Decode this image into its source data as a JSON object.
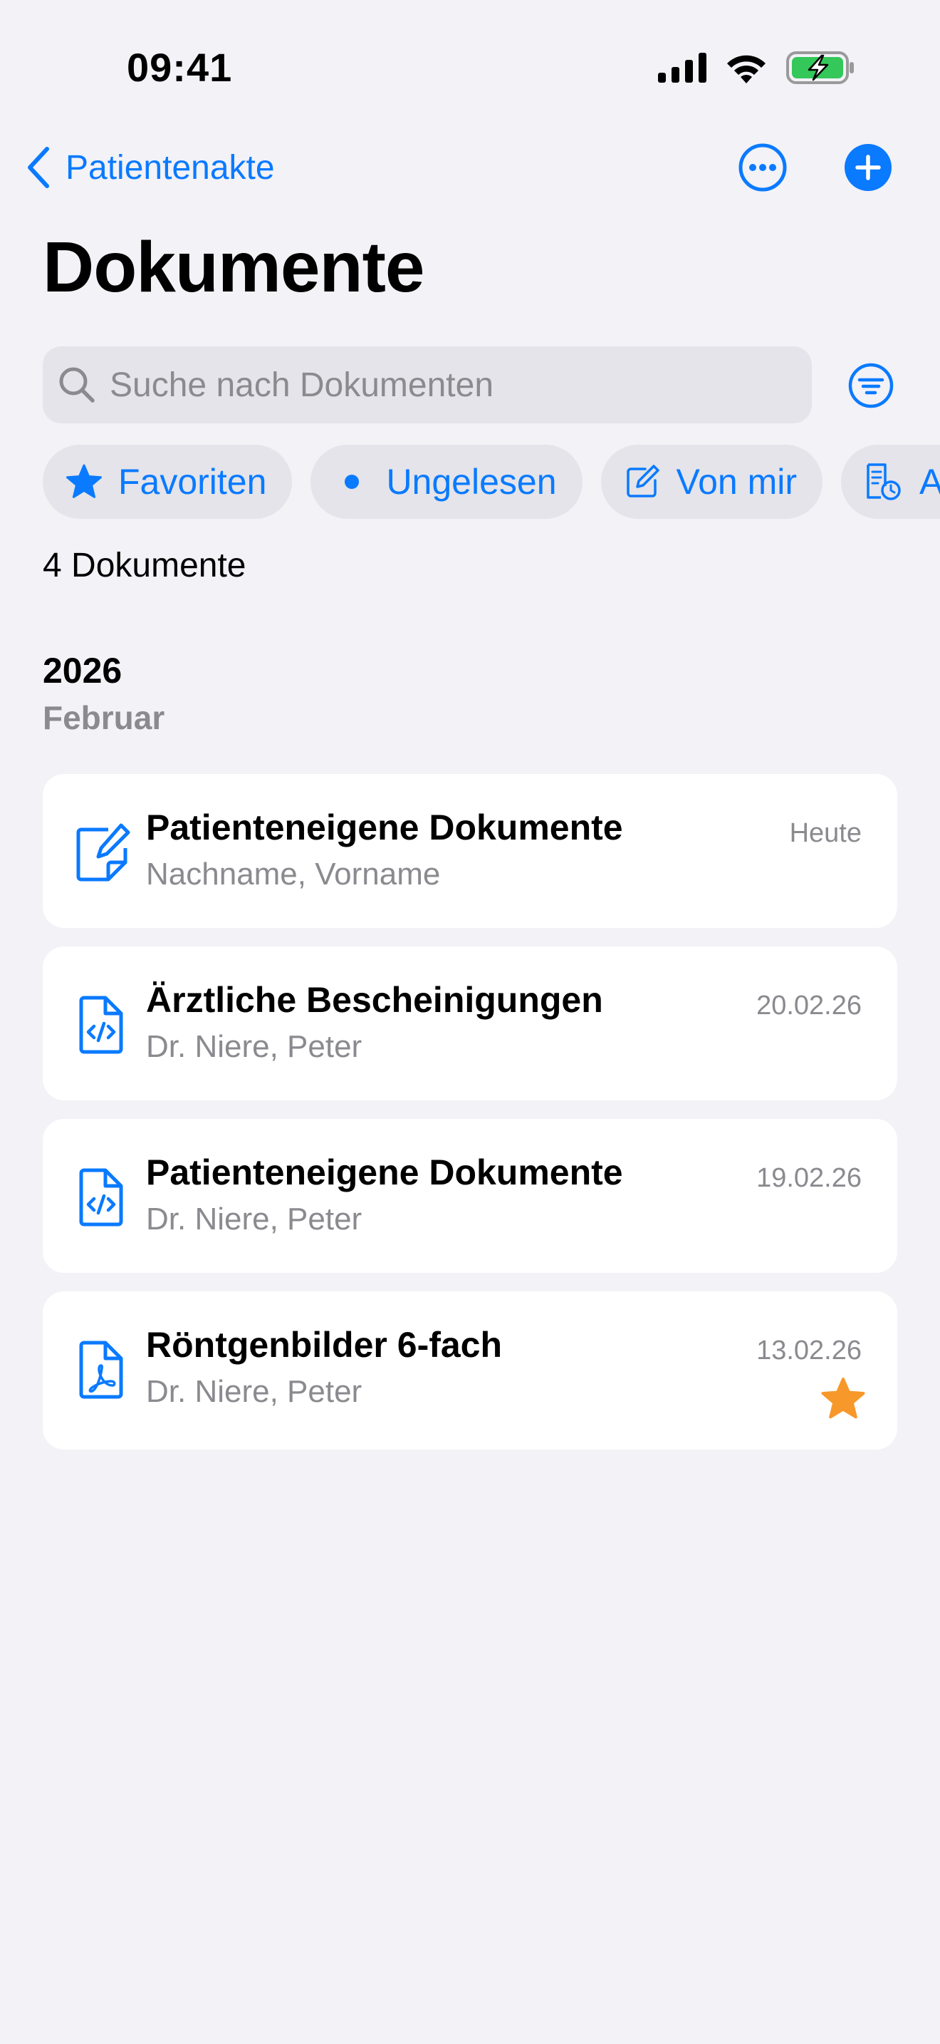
{
  "status_bar": {
    "time": "09:41"
  },
  "nav": {
    "back_label": "Patientenakte",
    "title": "Dokumente"
  },
  "search": {
    "placeholder": "Suche nach Dokumenten"
  },
  "filter_chips": [
    {
      "label": "Favoriten",
      "icon": "star-icon"
    },
    {
      "label": "Ungelesen",
      "icon": "dot-icon"
    },
    {
      "label": "Von mir",
      "icon": "edit-icon"
    },
    {
      "label": "A",
      "icon": "document-clock-icon"
    }
  ],
  "document_count": "4 Dokumente",
  "section": {
    "year": "2026",
    "month": "Februar"
  },
  "documents": [
    {
      "title": "Patienteneigene Dokumente",
      "subtitle": "Nachname, Vorname",
      "date": "Heute",
      "icon": "edit-document-icon",
      "favorite": false
    },
    {
      "title": "Ärztliche Bescheinigungen",
      "subtitle": "Dr. Niere, Peter",
      "date": "20.02.26",
      "icon": "code-document-icon",
      "favorite": false
    },
    {
      "title": "Patienteneigene Dokumente",
      "subtitle": "Dr. Niere, Peter",
      "date": "19.02.26",
      "icon": "code-document-icon",
      "favorite": false
    },
    {
      "title": "Röntgenbilder 6-fach",
      "subtitle": "Dr. Niere, Peter",
      "date": "13.02.26",
      "icon": "pdf-document-icon",
      "favorite": true
    }
  ],
  "colors": {
    "accent": "#0A7AFF",
    "favorite": "#F7982A",
    "background": "#F2F2F7",
    "battery": "#34C759"
  }
}
